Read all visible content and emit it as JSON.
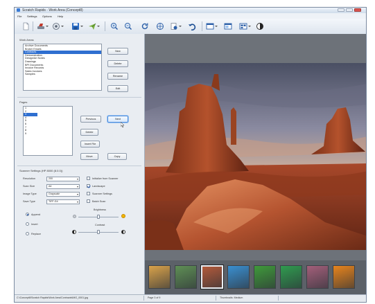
{
  "window": {
    "title": "Scratch Rapids · Work Area (Concept8)"
  },
  "menu": [
    "File",
    "Settings",
    "Options",
    "Help"
  ],
  "panel": {
    "work_areas_label": "Work Areas",
    "work_areas": [
      "Archive Documents",
      "Broker Emails",
      "Contracts",
      "Demonstration",
      "Design/Art Notes",
      "Drawings",
      "BPI Documents",
      "Invoice Records",
      "Sales Invoices",
      "Samples"
    ],
    "work_area_selected": 2,
    "work_area_buttons": [
      "New",
      "Delete",
      "Rename",
      "Edit"
    ],
    "pages_label": "Pages",
    "pages": [
      "1",
      "2",
      "3",
      "4",
      "5",
      "6",
      "7",
      "8",
      "9"
    ],
    "page_selected": 2,
    "page_buttons": {
      "previous": "Previous",
      "next": "Next",
      "delete": "Delete",
      "insert_file": "Insert File",
      "move": "Move",
      "copy": "Copy"
    },
    "scanner_label": "Scanner Settings (HP 8000 (8.0.0))",
    "resolution_label": "Resolution",
    "resolution_value": "200",
    "scan_size_label": "Scan Size",
    "scan_size_value": "A4",
    "image_type_label": "Image Type",
    "image_type_value": "Grayscale",
    "save_type_label": "Save Type",
    "save_type_value": "TIFF-G4",
    "checks": [
      {
        "label": "Initialize from Scanner",
        "checked": false
      },
      {
        "label": "Landscape",
        "checked": true
      },
      {
        "label": "Scanner Settings",
        "checked": false
      },
      {
        "label": "Batch Scan",
        "checked": false
      }
    ],
    "radios": [
      {
        "label": "Append",
        "checked": true
      },
      {
        "label": "Insert",
        "checked": false
      },
      {
        "label": "Replace",
        "checked": false
      }
    ],
    "brightness_label": "Brightness",
    "contrast_label": "Contrast",
    "brightness_level": 0.5,
    "contrast_level": 0.5
  },
  "thumbnails": {
    "count": 8,
    "selected": 2,
    "colors": [
      "#d9a24a",
      "#5f8f55",
      "#b35a3a",
      "#3a8fd0",
      "#3f9a3a",
      "#2f9b4f",
      "#a35f7a",
      "#e8841c"
    ]
  },
  "status": {
    "path": "C:\\Concept8\\Scratch Rapids\\Work Area\\Contracts\\IMG_0001.jpg",
    "page": "Page 3 of 9",
    "thumb_size": "Thumbnails: Medium"
  }
}
